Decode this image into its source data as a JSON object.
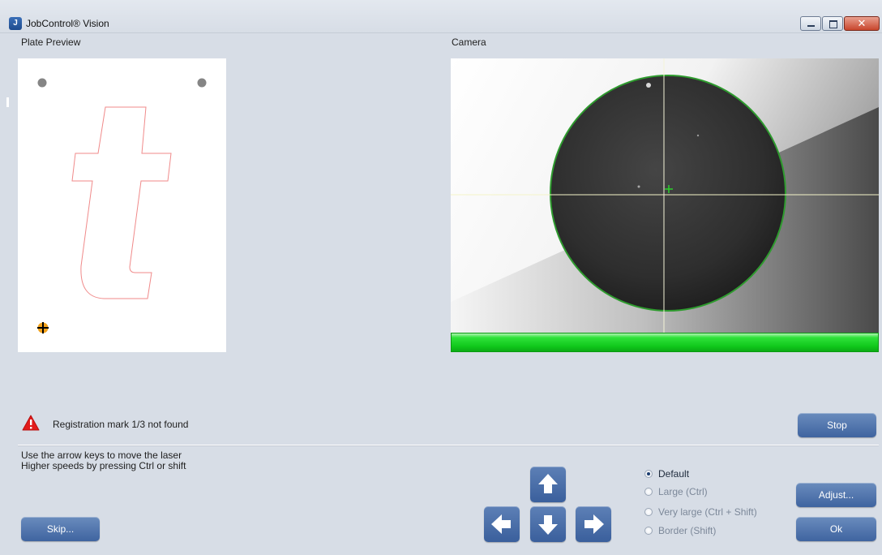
{
  "window": {
    "title": "JobControl® Vision",
    "icon": "app-icon",
    "icon_glyph": "J"
  },
  "plate_preview": {
    "label": "Plate Preview",
    "outline_color": "#f08a8a",
    "registration_marks": [
      "gray-circle",
      "gray-circle",
      "orange-crosshair"
    ]
  },
  "camera": {
    "label": "Camera",
    "status_bar_color": "#10c81b"
  },
  "status": {
    "icon": "warning-icon",
    "message": "Registration mark 1/3 not found"
  },
  "buttons": {
    "stop": "Stop",
    "adjust": "Adjust...",
    "ok": "Ok",
    "skip": "Skip..."
  },
  "hints": {
    "line1": "Use the arrow keys to move the laser",
    "line2": "Higher speeds by pressing Ctrl or shift"
  },
  "arrows": {
    "up": "arrow-up-icon",
    "down": "arrow-down-icon",
    "left": "arrow-left-icon",
    "right": "arrow-right-icon"
  },
  "step_size": {
    "options": [
      {
        "label": "Default",
        "checked": true
      },
      {
        "label": "Large (Ctrl)",
        "checked": false
      },
      {
        "label": "Very large (Ctrl + Shift)",
        "checked": false
      },
      {
        "label": "Border (Shift)",
        "checked": false
      }
    ]
  },
  "colors": {
    "background": "#d7dde6",
    "button": "#4f73ad",
    "warning": "#e21b1b"
  }
}
